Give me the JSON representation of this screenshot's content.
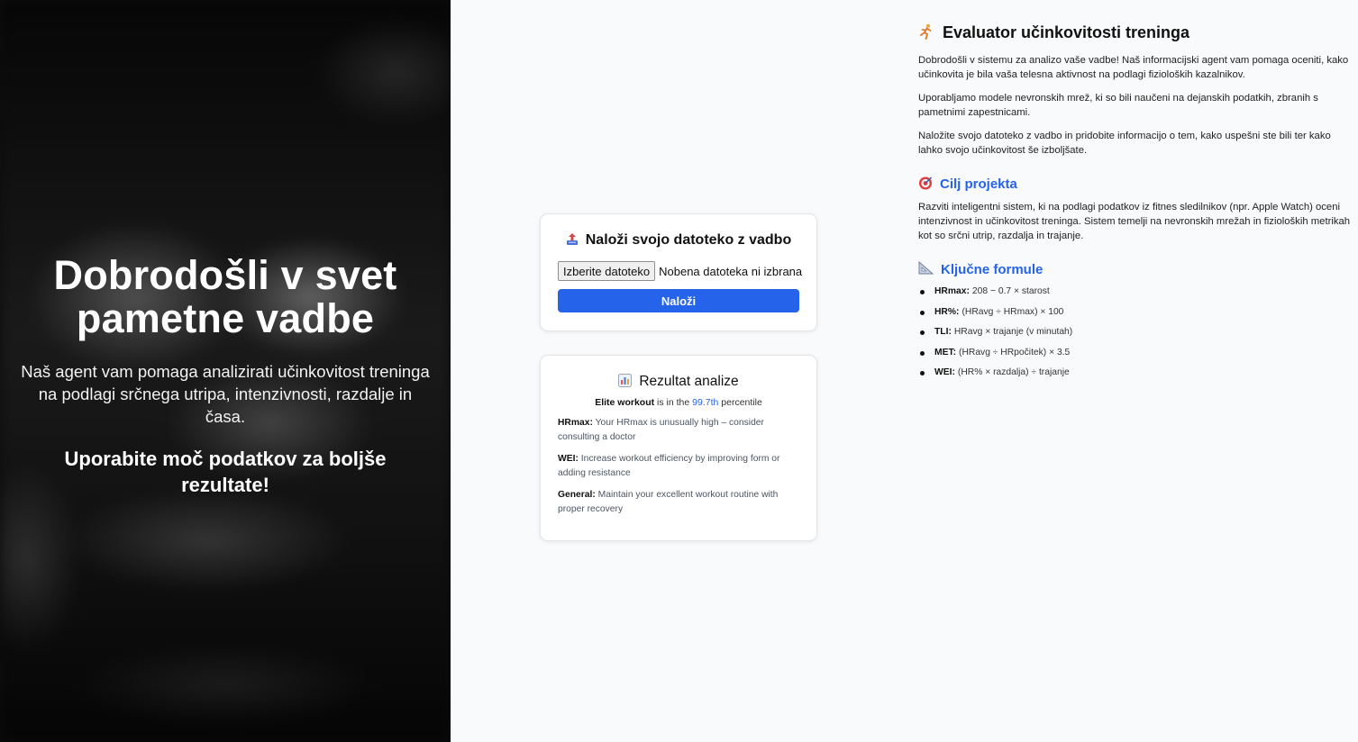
{
  "hero": {
    "title": "Dobrodošli v svet pametne vadbe",
    "subtitle": "Naš agent vam pomaga analizirati učinkovitost treninga na podlagi srčnega utripa, intenzivnosti, razdalje in časa.",
    "cta": "Uporabite moč podatkov za boljše rezultate!"
  },
  "upload": {
    "icon": "upload-tray-icon",
    "title": "Naloži svojo datoteko z vadbo",
    "choose_file_label": "Izberite datoteko",
    "file_status": "Nobena datoteka ni izbrana",
    "submit_label": "Naloži"
  },
  "result": {
    "icon": "bar-chart-icon",
    "title": "Rezultat analize",
    "summary_category": "Elite workout",
    "summary_middle": " is in the ",
    "summary_percentile": "99.7th",
    "summary_end": " percentile",
    "recommendations": [
      {
        "key": "HRmax:",
        "text": " Your HRmax is unusually high – consider consulting a doctor"
      },
      {
        "key": "WEI:",
        "text": " Increase workout efficiency by improving form or adding resistance"
      },
      {
        "key": "General:",
        "text": " Maintain your excellent workout routine with proper recovery"
      }
    ]
  },
  "info": {
    "title_icon": "runner-icon",
    "title": "Evaluator učinkovitosti treninga",
    "paragraphs": [
      "Dobrodošli v sistemu za analizo vaše vadbe! Naš informacijski agent vam pomaga oceniti, kako učinkovita je bila vaša telesna aktivnost na podlagi fizioloških kazalnikov.",
      "Uporabljamo modele nevronskih mrež, ki so bili naučeni na dejanskih podatkih, zbranih s pametnimi zapestnicami.",
      "Naložite svojo datoteko z vadbo in pridobite informacijo o tem, kako uspešni ste bili ter kako lahko svojo učinkovitost še izboljšate."
    ],
    "goal_icon": "target-icon",
    "goal_title": "Cilj projekta",
    "goal_text": "Razviti inteligentni sistem, ki na podlagi podatkov iz fitnes sledilnikov (npr. Apple Watch) oceni intenzivnost in učinkovitost treninga. Sistem temelji na nevronskih mrežah in fizioloških metrikah kot so srčni utrip, razdalja in trajanje.",
    "formulas_icon": "triangle-ruler-icon",
    "formulas_title": "Ključne formule",
    "formulas": [
      {
        "key": "HRmax:",
        "text": "208 − 0.7 × starost"
      },
      {
        "key": "HR%:",
        "text": "(HRavg ÷ HRmax) × 100"
      },
      {
        "key": "TLI:",
        "text": "HRavg × trajanje (v minutah)"
      },
      {
        "key": "MET:",
        "text": "(HRavg ÷ HRpočitek) × 3.5"
      },
      {
        "key": "WEI:",
        "text": "(HR% × razdalja) ÷ trajanje"
      }
    ]
  },
  "colors": {
    "accent": "#2563eb",
    "page_bg": "#f9fafb",
    "hero_bg": "#0c0c0c"
  }
}
